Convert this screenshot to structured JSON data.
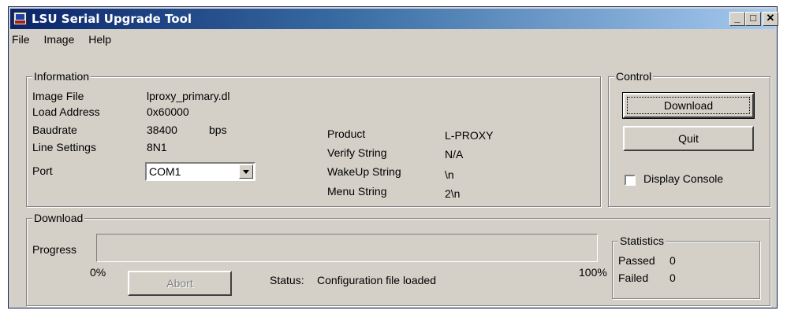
{
  "window": {
    "title": "LSU Serial Upgrade Tool",
    "controls": {
      "minimize": "_",
      "maximize": "□",
      "close": "✕"
    }
  },
  "menu": [
    "File",
    "Image",
    "Help"
  ],
  "information": {
    "label": "Information",
    "image_file_label": "Image File",
    "image_file_value": "lproxy_primary.dl",
    "load_address_label": "Load Address",
    "load_address_value": "0x60000",
    "baudrate_label": "Baudrate",
    "baudrate_value": "38400",
    "baudrate_unit": "bps",
    "line_settings_label": "Line Settings",
    "line_settings_value": "8N1",
    "port_label": "Port",
    "port_value": "COM1",
    "product_label": "Product",
    "product_value": "L-PROXY",
    "verify_label": "Verify String",
    "verify_value": "N/A",
    "wakeup_label": "WakeUp String",
    "wakeup_value": "\\n",
    "menu_label": "Menu String",
    "menu_value": "2\\n"
  },
  "control": {
    "label": "Control",
    "download_button": "Download",
    "quit_button": "Quit",
    "display_console_label": "Display Console",
    "display_console_checked": false
  },
  "download": {
    "label": "Download",
    "progress_label": "Progress",
    "progress_value": 0,
    "min_label": "0%",
    "max_label": "100%",
    "abort_button": "Abort",
    "status_label": "Status:",
    "status_value": "Configuration file loaded"
  },
  "statistics": {
    "label": "Statistics",
    "passed_label": "Passed",
    "passed_value": "0",
    "failed_label": "Failed",
    "failed_value": "0"
  }
}
